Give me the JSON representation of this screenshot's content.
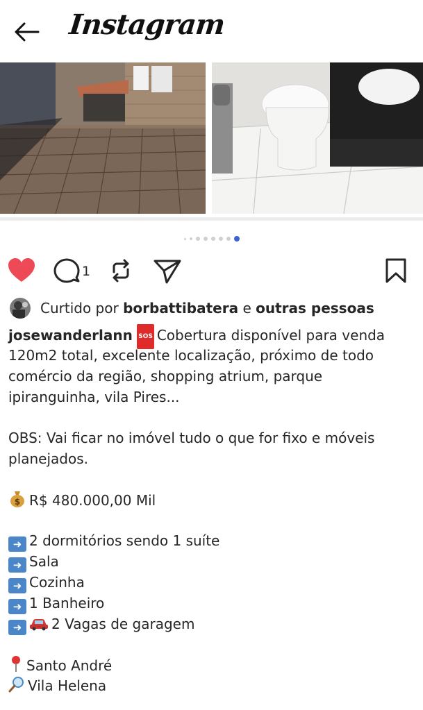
{
  "header": {
    "back_icon": "arrow-left-icon",
    "logo_text": "Instagram"
  },
  "carousel": {
    "photos": [
      "patio-photo",
      "bathroom-photo"
    ],
    "dot_count": 8,
    "active_index": 7,
    "accent_color": "#3d62d6"
  },
  "actions": {
    "like_icon": "heart-filled-icon",
    "like_color": "#ed4956",
    "comment_icon": "comment-icon",
    "comment_count": "1",
    "repost_icon": "repost-icon",
    "share_icon": "send-icon",
    "save_icon": "bookmark-icon"
  },
  "likes": {
    "prefix": "Curtido por",
    "user": "borbattibatera",
    "connector": "e",
    "others": "outras pessoas"
  },
  "post": {
    "username": "josewanderlann",
    "sos_badge": "SOS",
    "lines": [
      "Cobertura disponível para venda",
      "120m2 total, excelente localização, próximo de todo",
      "comércio da região, shopping atrium, parque",
      "ipiranguinha, vila Pires..."
    ],
    "obs_lines": [
      "OBS: Vai ficar no imóvel tudo o que for fixo e móveis",
      "planejados."
    ],
    "price": "R$ 480.000,00  Mil",
    "features": [
      "2 dormitórios sendo 1 suíte",
      "Sala",
      "Cozinha",
      "1 Banheiro",
      "2 Vagas de garagem"
    ],
    "location_city": "Santo André",
    "location_neighborhood": "Vila Helena"
  }
}
